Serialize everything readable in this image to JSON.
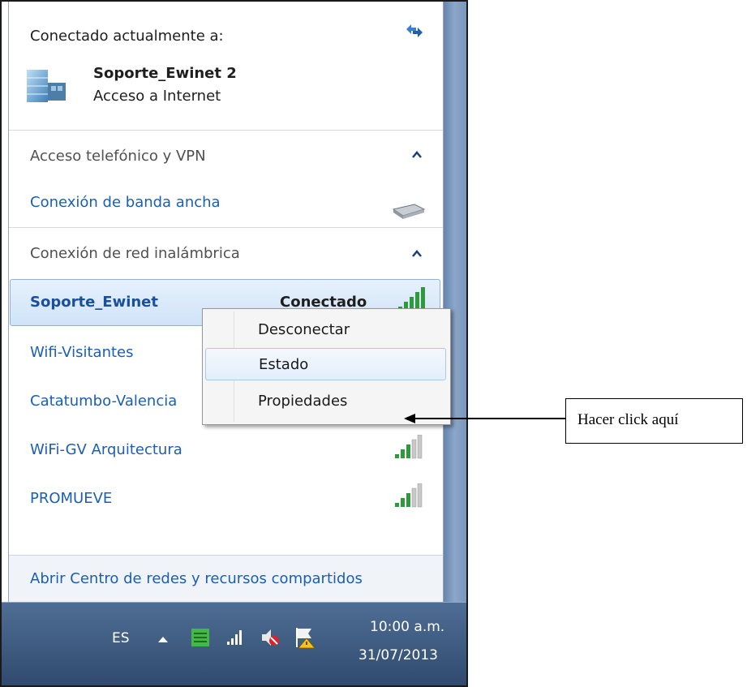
{
  "header": {
    "title": "Conectado actualmente a:"
  },
  "current_connection": {
    "name": "Soporte_Ewinet  2",
    "status": "Acceso a Internet"
  },
  "dialup_section": {
    "title": "Acceso telefónico y VPN",
    "item": "Conexión de banda ancha"
  },
  "wireless_section": {
    "title": "Conexión de red inalámbrica",
    "networks": [
      {
        "name": "Soporte_Ewinet",
        "status": "Conectado"
      },
      {
        "name": "Wifi-Visitantes",
        "status": ""
      },
      {
        "name": "Catatumbo-Valencia",
        "status": ""
      },
      {
        "name": "WiFi-GV Arquitectura",
        "status": ""
      },
      {
        "name": "PROMUEVE",
        "status": ""
      }
    ]
  },
  "context_menu": {
    "items": [
      "Desconectar",
      "Estado",
      "Propiedades"
    ]
  },
  "footer": {
    "link": "Abrir Centro de redes y recursos compartidos"
  },
  "taskbar": {
    "language": "ES",
    "time": "10:00 a.m.",
    "date": "31/07/2013"
  },
  "annotation": {
    "label": "Hacer click aquí"
  },
  "icons": [
    "refresh-icon",
    "network-building-icon",
    "chevron-up-icon",
    "modem-icon",
    "signal-bars-icon",
    "arrow-up-icon",
    "network-tray-icon",
    "volume-muted-icon",
    "action-center-flag-icon"
  ],
  "colors": {
    "link": "#1a5fb4",
    "selected": "#cfe3f8",
    "taskbar": "#2f4a6d"
  }
}
